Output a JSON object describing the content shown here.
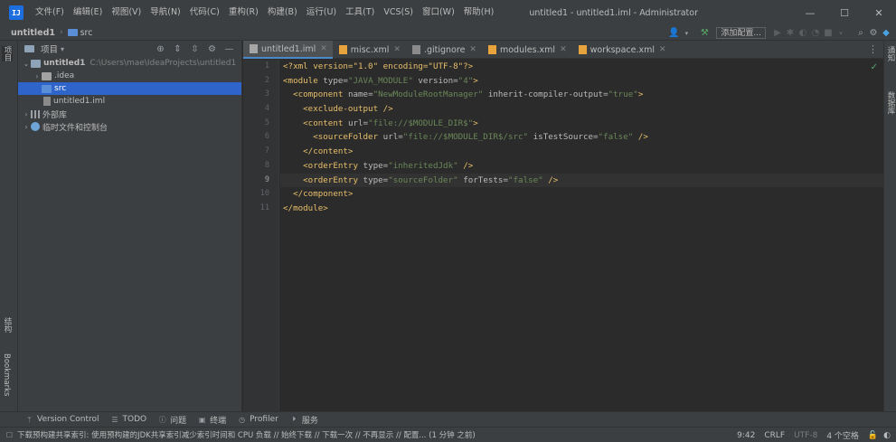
{
  "titlebar": {
    "logo": "IJ",
    "menu": [
      "文件(F)",
      "编辑(E)",
      "视图(V)",
      "导航(N)",
      "代码(C)",
      "重构(R)",
      "构建(B)",
      "运行(U)",
      "工具(T)",
      "VCS(S)",
      "窗口(W)",
      "帮助(H)"
    ],
    "window_title": "untitled1 - untitled1.iml - Administrator",
    "controls": [
      "—",
      "☐",
      "✕"
    ]
  },
  "navbar": {
    "project": "untitled1",
    "folder": "src",
    "add_config": "添加配置..."
  },
  "left_stripe": {
    "top_tab": "项目",
    "mid_tab": "结构",
    "bottom_tab": "Bookmarks"
  },
  "right_stripe": {
    "tab1": "通知",
    "tab2": "数据库"
  },
  "project_panel": {
    "title": "项目",
    "tree": [
      {
        "label": "untitled1",
        "path": "C:\\Users\\mae\\IdeaProjects\\untitled1"
      },
      {
        "label": ".idea"
      },
      {
        "label": "src"
      },
      {
        "label": "untitled1.iml"
      },
      {
        "label": "外部库"
      },
      {
        "label": "临时文件和控制台"
      }
    ]
  },
  "editor": {
    "tabs": [
      "untitled1.iml",
      "misc.xml",
      ".gitignore",
      "modules.xml",
      "workspace.xml"
    ],
    "line_numbers": [
      "1",
      "2",
      "3",
      "4",
      "5",
      "6",
      "7",
      "8",
      "9",
      "10",
      "11"
    ],
    "code": {
      "l1": "<?xml version=\"1.0\" encoding=\"UTF-8\"?>",
      "l2_tag": "<module",
      "l2_a1": " type=",
      "l2_v1": "\"JAVA_MODULE\"",
      "l2_a2": " version=",
      "l2_v2": "\"4\"",
      "l2_end": ">",
      "l3_tag": "<component",
      "l3_a1": " name=",
      "l3_v1": "\"NewModuleRootManager\"",
      "l3_a2": " inherit-compiler-output=",
      "l3_v2": "\"true\"",
      "l3_end": ">",
      "l4": "<exclude-output />",
      "l5_tag": "<content",
      "l5_a1": " url=",
      "l5_v1": "\"file://$MODULE_DIR$\"",
      "l5_end": ">",
      "l6_tag": "<sourceFolder",
      "l6_a1": " url=",
      "l6_v1": "\"file://$MODULE_DIR$/src\"",
      "l6_a2": " isTestSource=",
      "l6_v2": "\"false\"",
      "l6_end": " />",
      "l7": "</content>",
      "l8_tag": "<orderEntry",
      "l8_a1": " type=",
      "l8_v1": "\"inheritedJdk\"",
      "l8_end": " />",
      "l9_tag": "<orderEntry",
      "l9_a1": " type=",
      "l9_v1": "\"sourceFolder\"",
      "l9_a2": " forTests=",
      "l9_v2": "\"false\"",
      "l9_end": " />",
      "l10": "</component>",
      "l11": "</module>"
    }
  },
  "tool_windows": [
    "Version Control",
    "TODO",
    "问题",
    "终端",
    "Profiler",
    "服务"
  ],
  "statusbar": {
    "message": "下载预构建共享索引: 使用预构建的JDK共享索引减少索引时间和 CPU 负载 // 始终下载 // 下载一次 // 不再显示 // 配置... (1 分钟 之前)",
    "position": "9:42",
    "line_sep": "CRLF",
    "encoding": "UTF-8",
    "indent": "4 个空格"
  },
  "colors": {
    "accent": "#2f65ca",
    "tag": "#e8bf6a",
    "string": "#6a8759",
    "bg": "#2b2b2b",
    "panel": "#3c3f41"
  }
}
